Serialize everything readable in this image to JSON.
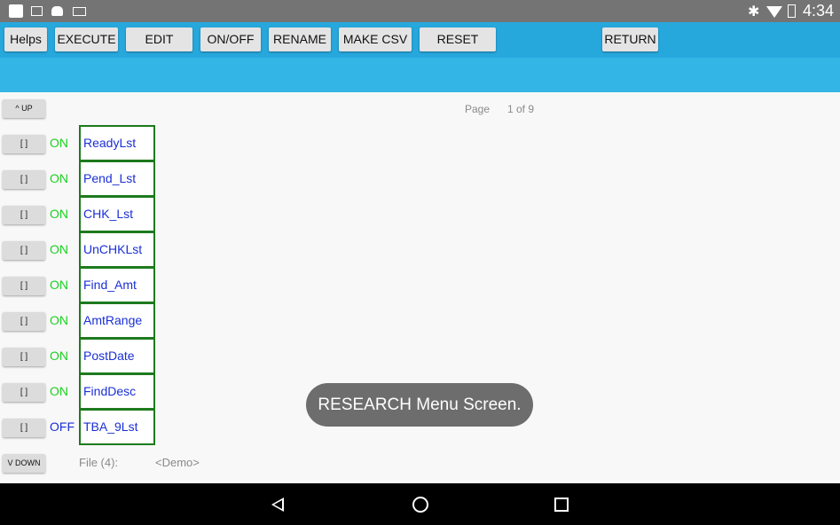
{
  "status_bar": {
    "time": "4:34"
  },
  "toolbar": {
    "buttons": [
      "Helps",
      "EXECUTE",
      "EDIT",
      "ON/OFF",
      "RENAME",
      "MAKE CSV",
      "RESET",
      "RETURN"
    ]
  },
  "nav": {
    "up_label": "^ UP",
    "down_label": "V DOWN"
  },
  "page": {
    "label": "Page",
    "value": "1 of 9"
  },
  "rows": [
    {
      "select": "[  ]",
      "state": "ON",
      "name": "ReadyLst"
    },
    {
      "select": "[  ]",
      "state": "ON",
      "name": "Pend_Lst"
    },
    {
      "select": "[  ]",
      "state": "ON",
      "name": "CHK_Lst"
    },
    {
      "select": "[  ]",
      "state": "ON",
      "name": "UnCHKLst"
    },
    {
      "select": "[  ]",
      "state": "ON",
      "name": "Find_Amt"
    },
    {
      "select": "[  ]",
      "state": "ON",
      "name": "AmtRange"
    },
    {
      "select": "[  ]",
      "state": "ON",
      "name": "PostDate"
    },
    {
      "select": "[  ]",
      "state": "ON",
      "name": "FindDesc"
    },
    {
      "select": "[  ]",
      "state": "OFF",
      "name": "TBA_9Lst"
    }
  ],
  "file": {
    "label": "File (4):",
    "value": "<Demo>"
  },
  "toast": "RESEARCH Menu Screen.",
  "colors": {
    "toolbar": "#27a8dd",
    "band": "#33b5e5",
    "on": "#19d11f",
    "off": "#1a2fd6",
    "box_border": "#1d7a1d"
  }
}
